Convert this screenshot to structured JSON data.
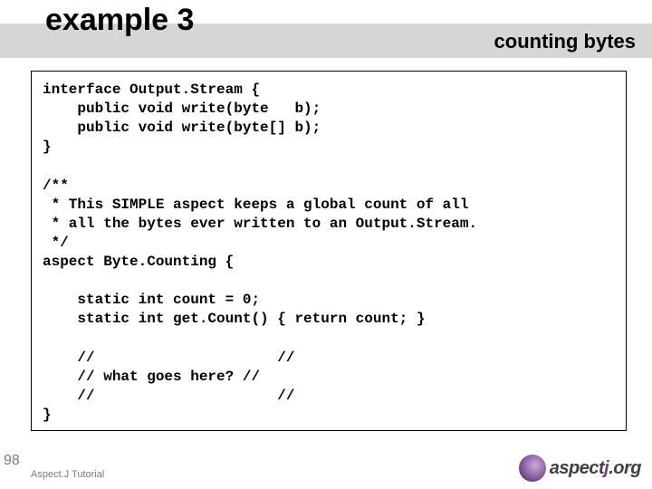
{
  "header": {
    "title": "example 3",
    "subtitle": "counting bytes"
  },
  "code": "interface Output.Stream {\n    public void write(byte   b);\n    public void write(byte[] b);\n}\n\n/**\n * This SIMPLE aspect keeps a global count of all\n * all the bytes ever written to an Output.Stream.\n */\naspect Byte.Counting {\n\n    static int count = 0;\n    static int get.Count() { return count; }\n\n    //                     //\n    // what goes here? //\n    //                     //\n}",
  "footer": {
    "slide_number": "98",
    "label": "Aspect.J Tutorial",
    "logo_text_a": "aspect",
    "logo_text_b": "j",
    "logo_text_c": ".org"
  }
}
